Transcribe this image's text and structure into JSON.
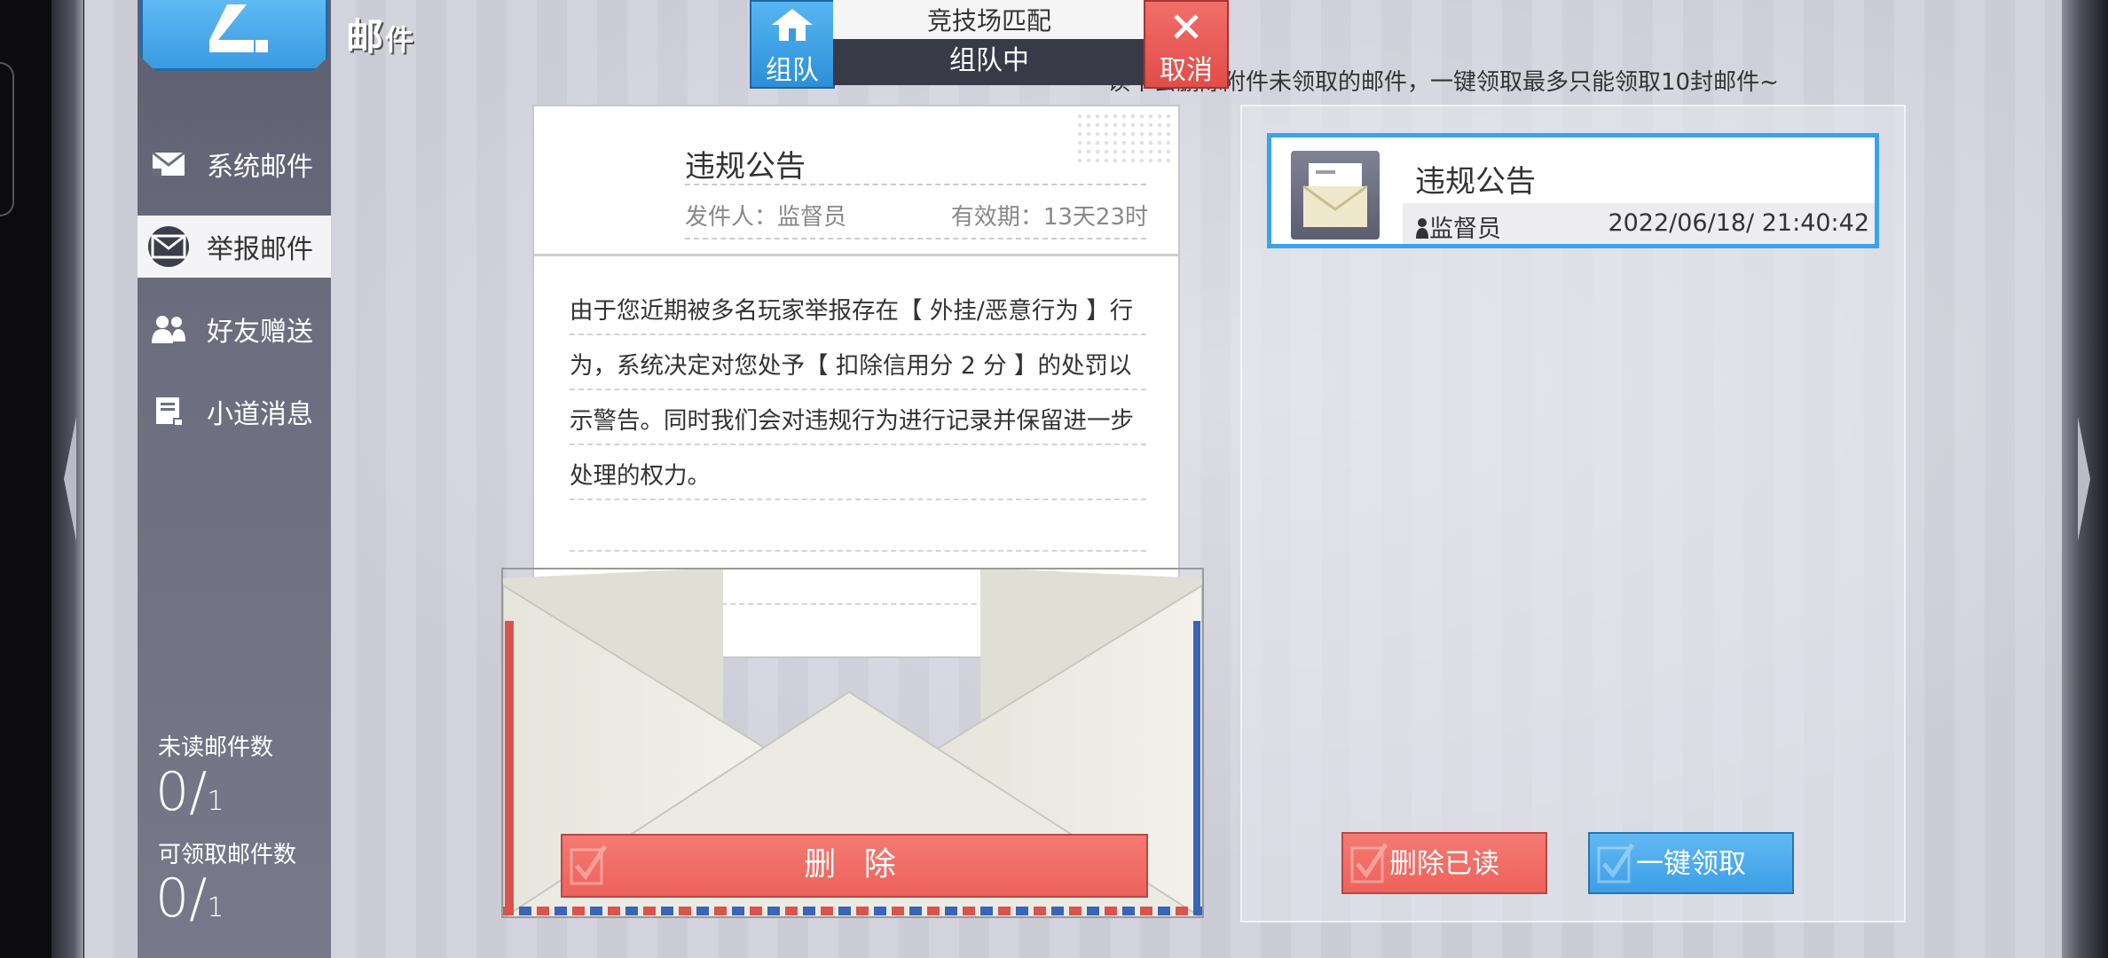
{
  "window": {
    "title_main": "邮",
    "title_small": "件"
  },
  "sidebar": {
    "items": [
      {
        "label": "系统邮件",
        "icon": "system-mail-icon",
        "active": false
      },
      {
        "label": "举报邮件",
        "icon": "report-mail-icon",
        "active": true
      },
      {
        "label": "好友赠送",
        "icon": "friends-gift-icon",
        "active": false
      },
      {
        "label": "小道消息",
        "icon": "gossip-news-icon",
        "active": false
      }
    ],
    "unread_label": "未读邮件数",
    "unread_count": "0/",
    "unread_total": "1",
    "claimable_label": "可领取邮件数",
    "claimable_count": "0/",
    "claimable_total": "1"
  },
  "match_banner": {
    "team_label": "组队",
    "mode": "竞技场匹配",
    "status": "组队中",
    "cancel_label": "取消"
  },
  "tip_text": "读不会删除附件未领取的邮件，一键领取最多只能领取10封邮件~",
  "letter": {
    "title": "违规公告",
    "sender": "发件人：监督员",
    "validity": "有效期：13天23时",
    "body": "由于您近期被多名玩家举报存在【 外挂/恶意行为 】行为，系统决定对您处予【 扣除信用分 2 分 】的处罚以示警告。同时我们会对违规行为进行记录并保留进一步处理的权力。",
    "delete_label": "删 除"
  },
  "mail_list": [
    {
      "title": "违规公告",
      "sender": "监督员",
      "date": "2022/06/18/ 21:40:42"
    }
  ],
  "buttons": {
    "delete_read": "删除已读",
    "claim_all": "一键领取"
  },
  "colors": {
    "accent_blue": "#3aa3ee",
    "danger_red": "#ee625b",
    "sidebar": "#6c6e7f"
  }
}
